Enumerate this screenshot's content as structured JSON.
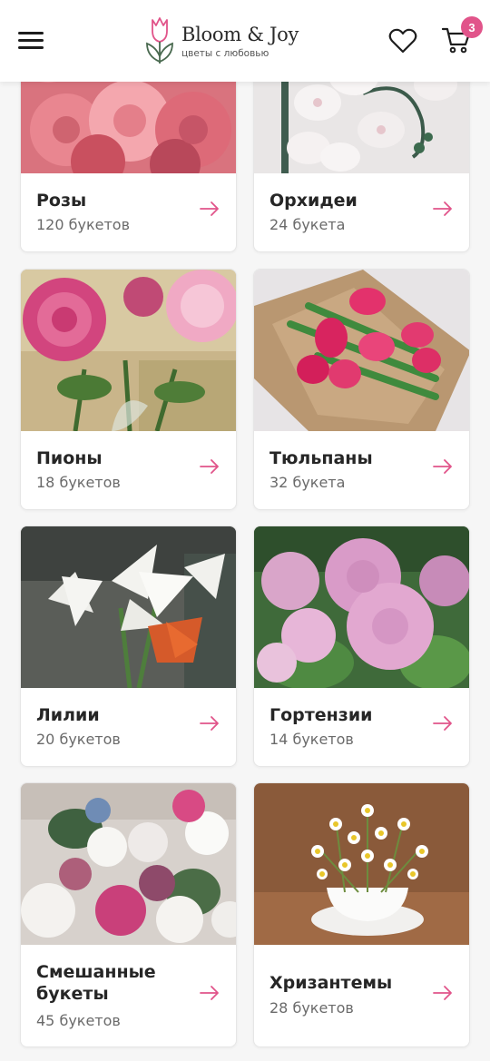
{
  "header": {
    "brand_name": "Bloom & Joy",
    "brand_tagline": "цветы с любовью",
    "cart_count": "3"
  },
  "colors": {
    "accent": "#e1548a",
    "text": "#262626",
    "muted": "#6a6a6a"
  },
  "categories": [
    {
      "title": "Розы",
      "count": "120 букетов",
      "photo": "pink roses"
    },
    {
      "title": "Орхидеи",
      "count": "24 букета",
      "photo": "white orchids"
    },
    {
      "title": "Пионы",
      "count": "18 букетов",
      "photo": "pink peonies"
    },
    {
      "title": "Тюльпаны",
      "count": "32 букета",
      "photo": "pink tulips in kraft paper"
    },
    {
      "title": "Лилии",
      "count": "20 букетов",
      "photo": "white lilies"
    },
    {
      "title": "Гортензии",
      "count": "14 букетов",
      "photo": "pink hydrangeas"
    },
    {
      "title": "Смешанные букеты",
      "count": "45 букетов",
      "photo": "mixed bouquet"
    },
    {
      "title": "Хризантемы",
      "count": "28 букетов",
      "photo": "chamomile chrysanthemums in a cup"
    }
  ]
}
